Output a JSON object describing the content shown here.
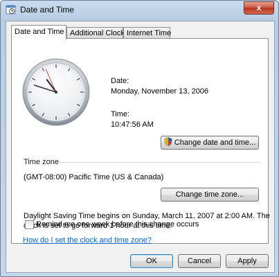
{
  "window": {
    "title": "Date and Time",
    "close_label": "x"
  },
  "tabs": [
    {
      "label": "Date and Time",
      "active": true
    },
    {
      "label": "Additional Clocks",
      "active": false
    },
    {
      "label": "Internet Time",
      "active": false
    }
  ],
  "clock": {
    "hour": 10,
    "minute": 47,
    "second": 56
  },
  "date": {
    "label": "Date:",
    "value": "Monday, November 13, 2006"
  },
  "time": {
    "label": "Time:",
    "value": "10:47:56 AM"
  },
  "buttons": {
    "change_date_time": "Change date and time...",
    "change_time_zone": "Change time zone...",
    "ok": "OK",
    "cancel": "Cancel",
    "apply": "Apply"
  },
  "timezone": {
    "section_label": "Time zone",
    "value": "(GMT-08:00) Pacific Time (US & Canada)"
  },
  "dst": {
    "line1": "Daylight Saving Time begins on Sunday, March 11, 2007 at 2:00 AM. The",
    "line2": "clock is set to go forward 1 hour at this time."
  },
  "reminder": {
    "label": "Remind me one week before this change occurs",
    "checked": false
  },
  "help_link": "How do I set the clock and time zone?",
  "icons": {
    "title": "clock-calendar-icon",
    "uac": "uac-shield-icon"
  },
  "colors": {
    "link": "#0066cc",
    "close_button": "#c8503a",
    "default_button_border": "#3c7fb1"
  }
}
